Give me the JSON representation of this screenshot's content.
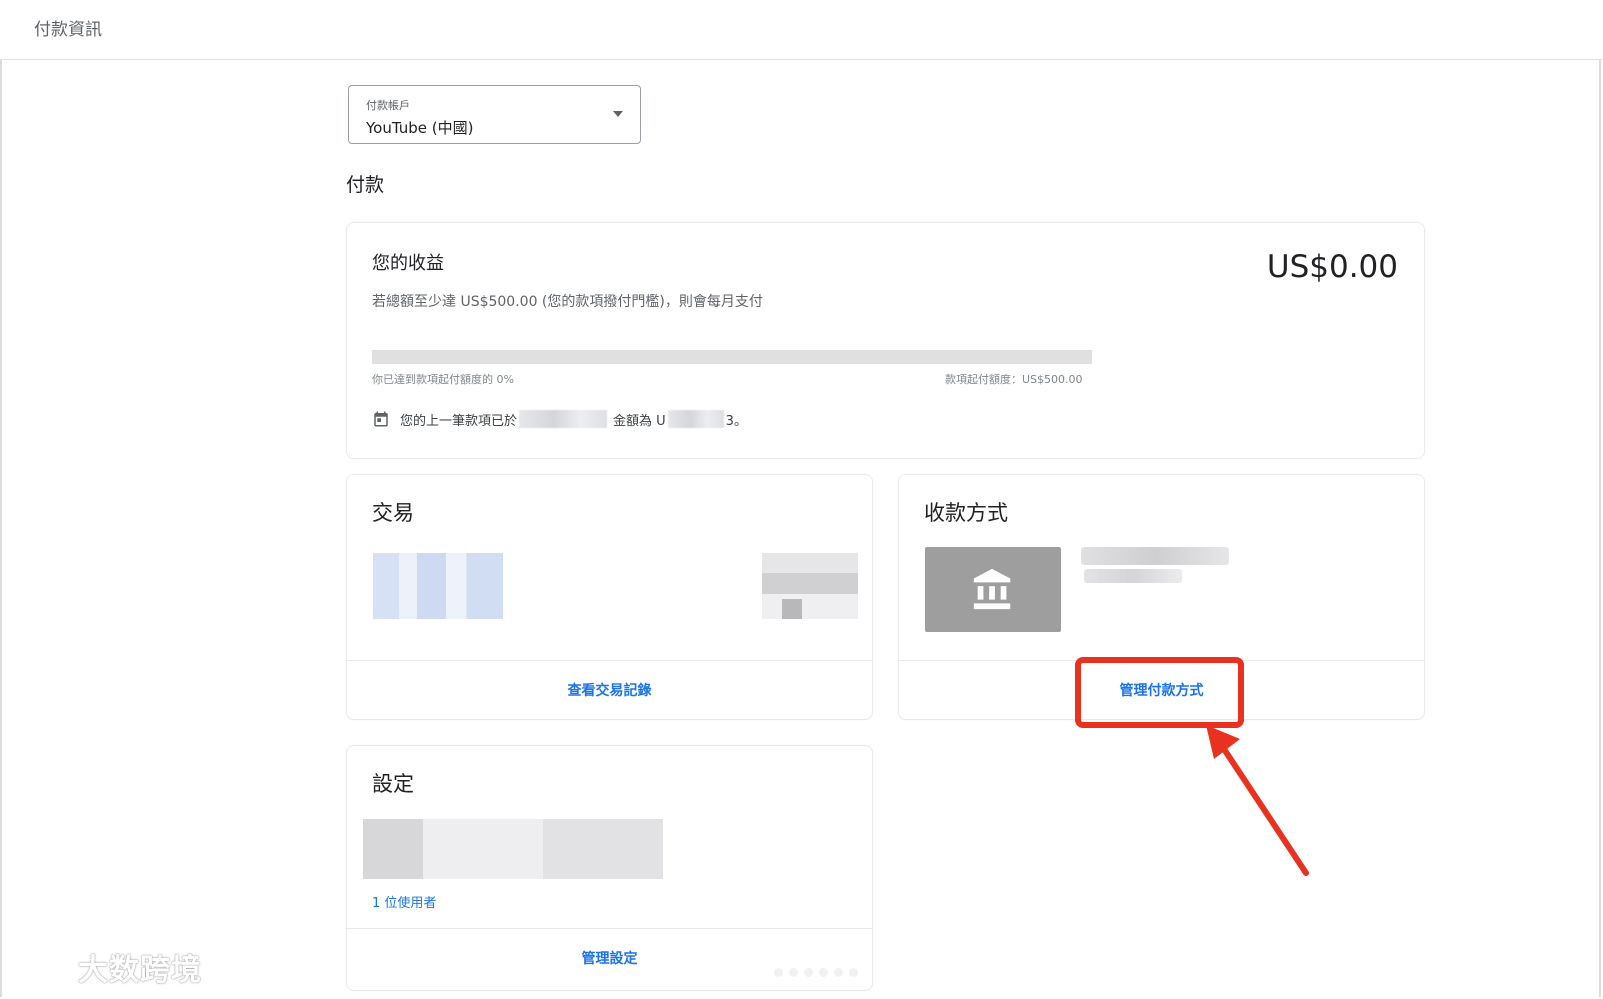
{
  "header": {
    "title": "付款資訊"
  },
  "account_select": {
    "label": "付款帳戶",
    "value": "YouTube (中國)"
  },
  "section_title": "付款",
  "earnings": {
    "title": "您的收益",
    "amount": "US$0.00",
    "description": "若總額至少達 US$500.00 (您的款項撥付門檻)，則會每月支付",
    "progress_percent": 0,
    "progress_left_label": "你已達到款項起付額度的 0%",
    "progress_right_label": "款項起付額度：US$500.00",
    "last_payment_prefix": "您的上一筆款項已於",
    "last_payment_middle": "金額為 U",
    "last_payment_suffix": "3。"
  },
  "transactions": {
    "title": "交易",
    "link": "查看交易記錄"
  },
  "payment_methods": {
    "title": "收款方式",
    "link": "管理付款方式"
  },
  "settings": {
    "title": "設定",
    "users": "1 位使用者",
    "link": "管理設定"
  },
  "watermark": {
    "text": "大数跨境"
  },
  "colors": {
    "accent": "#1a73e8",
    "highlight": "#e8321f",
    "bank_tile": "#9e9e9e"
  }
}
